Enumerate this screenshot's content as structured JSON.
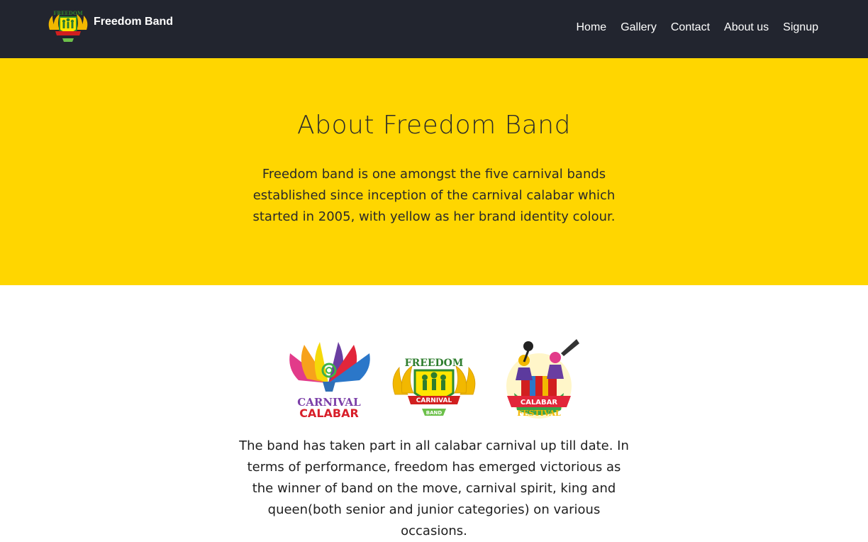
{
  "nav": {
    "brand_name": "Freedom Band",
    "links": [
      "Home",
      "Gallery",
      "Contact",
      "About us",
      "Signup"
    ]
  },
  "hero": {
    "title": "About Freedom Band",
    "description": "Freedom band is one amongst the five carnival bands established since inception of the carnival calabar which started in 2005, with yellow as her brand identity colour."
  },
  "content": {
    "logos": [
      {
        "name": "carnival-calabar-logo",
        "text_top": "CARNIVAL",
        "text_bottom": "CALABAR"
      },
      {
        "name": "freedom-carnival-band-logo",
        "text_top": "FREEDOM",
        "text_mid": "CARNIVAL",
        "text_bottom": "BAND"
      },
      {
        "name": "calabar-festival-logo",
        "text_top": "CALABAR",
        "text_bottom": "FESTIVAL"
      }
    ],
    "paragraph": "The band has taken part in all calabar carnival up till date. In terms of performance, freedom has emerged victorious as the winner of band on the move, carnival spirit, king and queen(both senior and junior categories) on various occasions."
  },
  "colors": {
    "navbar": "#22252f",
    "hero": "#ffd600",
    "text": "#222222"
  }
}
